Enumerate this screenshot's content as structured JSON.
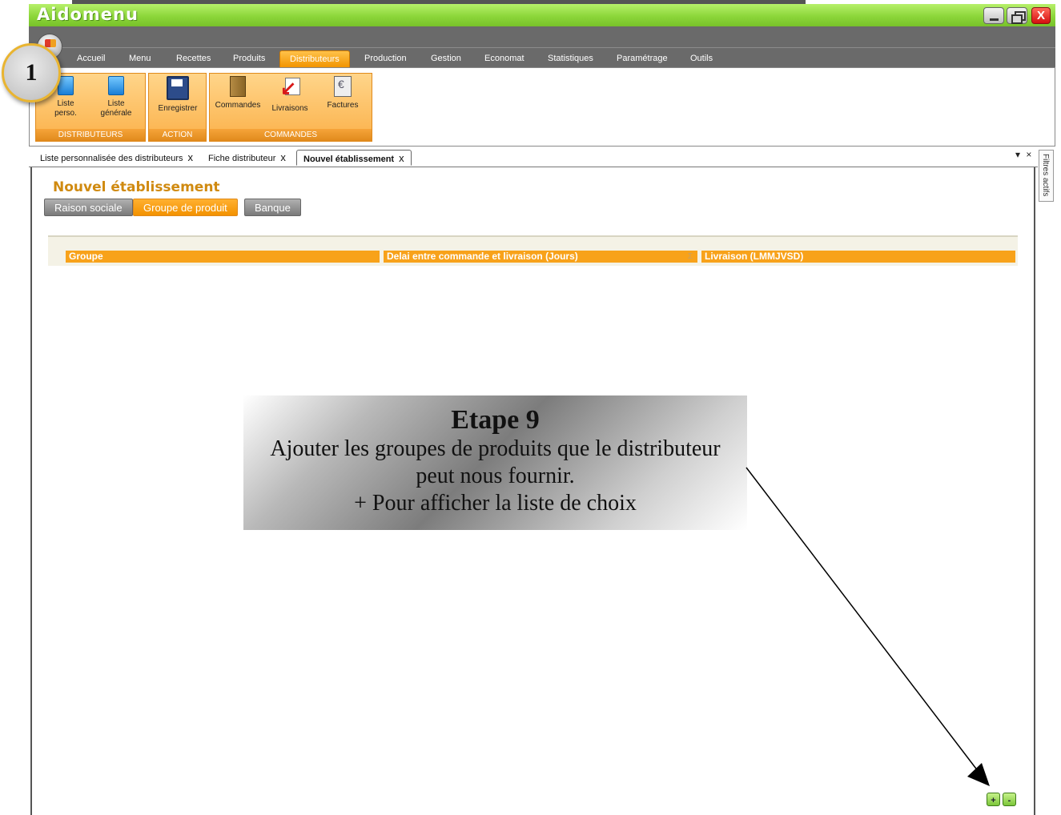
{
  "window": {
    "app_title": "Aidomenu",
    "close_label": "X"
  },
  "menu": {
    "items": [
      "Accueil",
      "Menu",
      "Recettes",
      "Produits",
      "Distributeurs",
      "Production",
      "Gestion",
      "Economat",
      "Statistiques",
      "Paramétrage",
      "Outils"
    ],
    "active": "Distributeurs"
  },
  "ribbon": {
    "groups": [
      {
        "label": "DISTRIBUTEURS",
        "tools": [
          {
            "line1": "Liste",
            "line2": "perso."
          },
          {
            "line1": "Liste",
            "line2": "générale"
          }
        ]
      },
      {
        "label": "ACTION",
        "tools": [
          {
            "line1": "Enregistrer"
          }
        ]
      },
      {
        "label": "COMMANDES",
        "tools": [
          {
            "line1": "Commandes"
          },
          {
            "line1": "Livraisons"
          },
          {
            "line1": "Factures"
          }
        ]
      }
    ]
  },
  "badge": {
    "number": "1"
  },
  "doc_tabs": [
    {
      "label": "Liste personnalisée des distributeurs",
      "close": "x"
    },
    {
      "label": "Fiche distributeur",
      "close": "x"
    },
    {
      "label": "Nouvel établissement",
      "close": "x"
    }
  ],
  "pane_controls": "▾ ×",
  "side_panel": {
    "label": "Filtres actifs"
  },
  "page": {
    "title": "Nouvel établissement",
    "subtabs": [
      "Raison sociale",
      "Groupe de produit",
      "Banque"
    ],
    "active_subtab": "Groupe de produit"
  },
  "grid": {
    "columns": [
      "Groupe",
      "Delai entre commande et livraison (Jours)",
      "Livraison (LMMJVSD)"
    ],
    "sort_indicator": "Σ"
  },
  "callout": {
    "step": "Etape 9",
    "line1": "Ajouter les groupes de produits que le distributeur",
    "line2": "peut nous fournir.",
    "line3": "+ Pour afficher la liste de choix"
  },
  "grid_buttons": {
    "add": "+",
    "remove": "-"
  },
  "colors": {
    "accent_orange": "#f8a21a",
    "title_green": "#8cd63a",
    "page_title": "#d08a10"
  }
}
